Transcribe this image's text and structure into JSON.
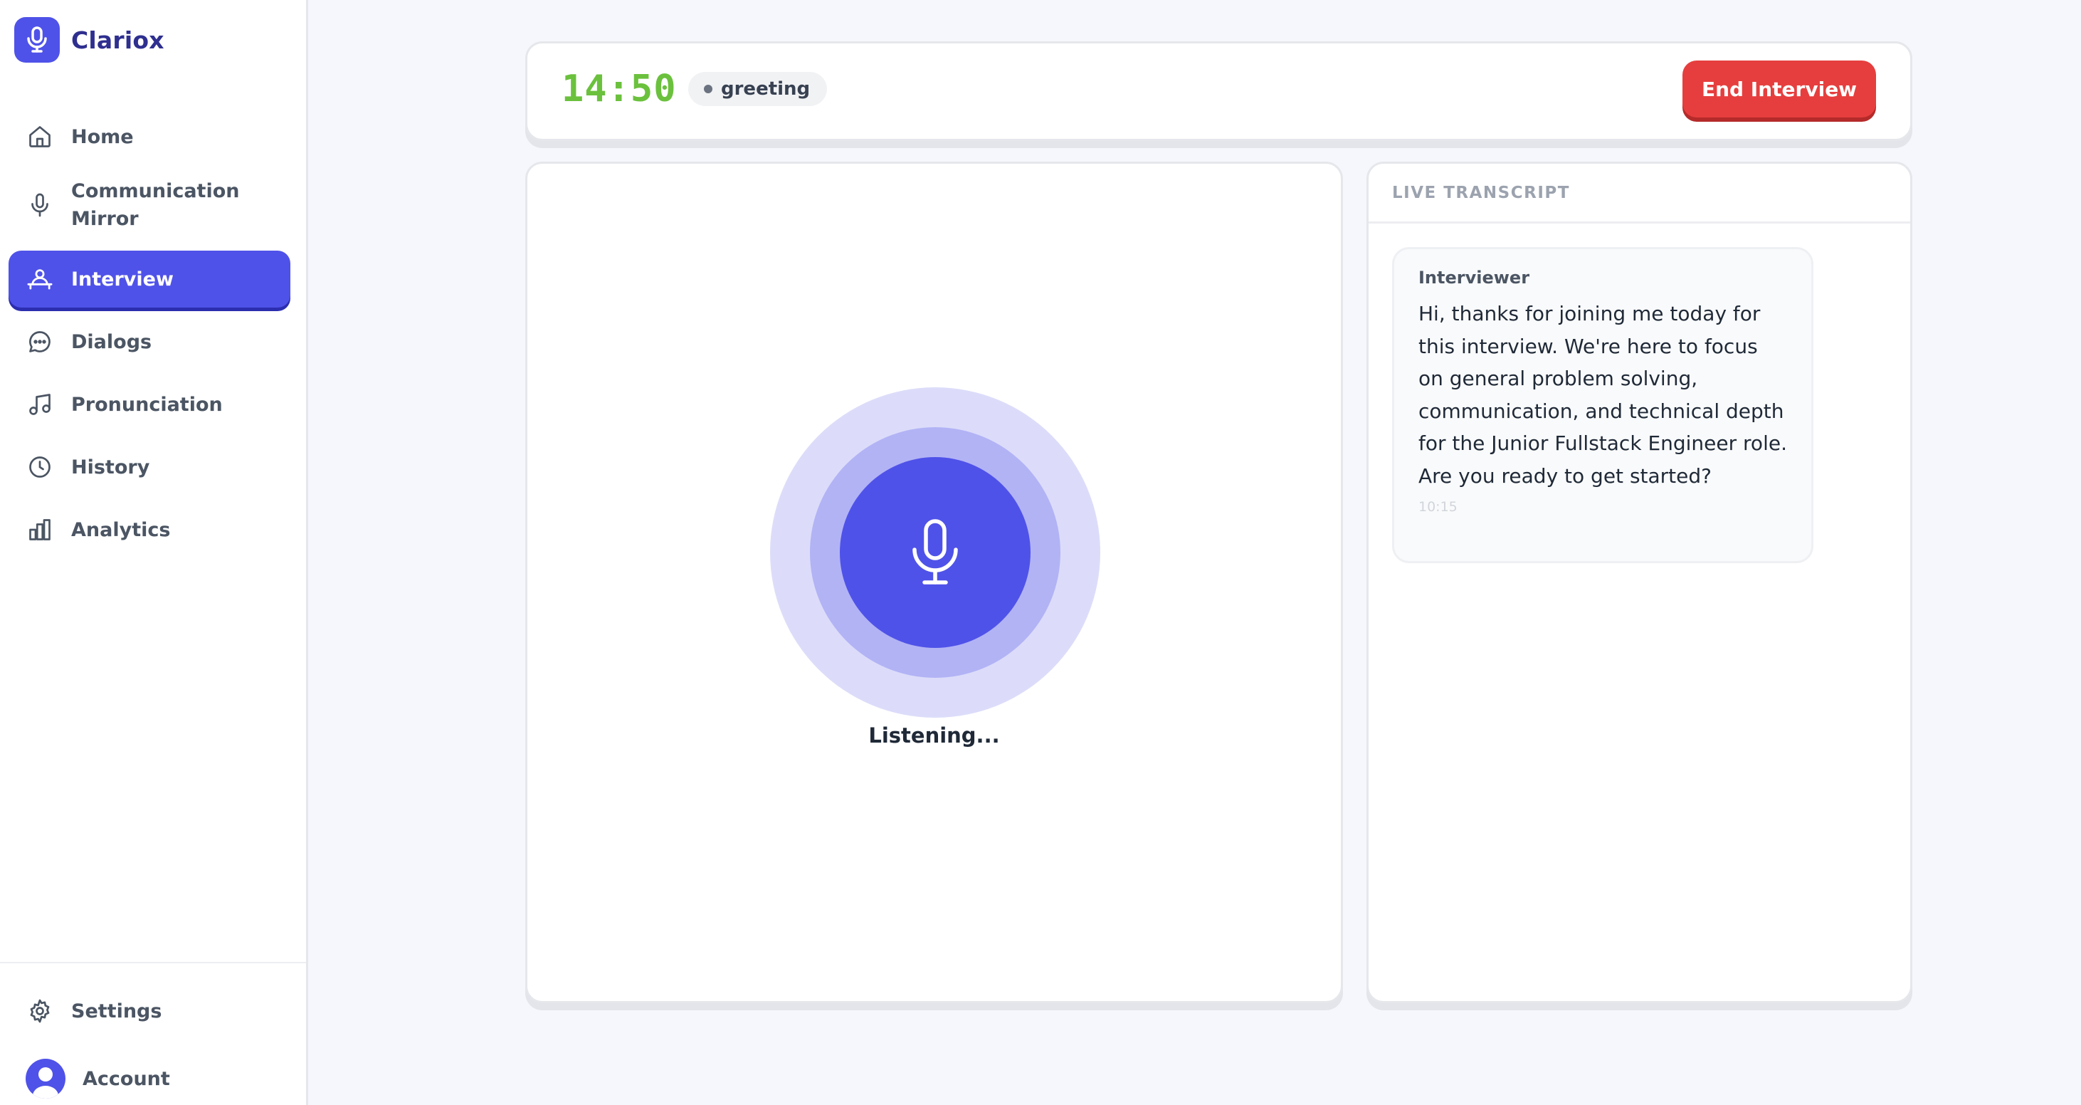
{
  "brand": {
    "name": "Clariox"
  },
  "sidebar": {
    "items": [
      {
        "label": "Home",
        "icon": "home-icon"
      },
      {
        "label": "Communication Mirror",
        "icon": "microphone-icon"
      },
      {
        "label": "Interview",
        "icon": "interview-icon",
        "active": true
      },
      {
        "label": "Dialogs",
        "icon": "chat-bubble-icon"
      },
      {
        "label": "Pronunciation",
        "icon": "music-note-icon"
      },
      {
        "label": "History",
        "icon": "clock-icon"
      },
      {
        "label": "Analytics",
        "icon": "bar-chart-icon"
      }
    ],
    "settings_label": "Settings",
    "account_label": "Account"
  },
  "header": {
    "timer": "14:50",
    "stage": "greeting",
    "end_button_label": "End Interview"
  },
  "mic": {
    "status": "Listening..."
  },
  "transcript": {
    "title": "LIVE TRANSCRIPT",
    "messages": [
      {
        "speaker": "Interviewer",
        "text": "Hi, thanks for joining me today for this interview. We're here to focus on general problem solving, communication, and technical depth for the Junior Fullstack Engineer role. Are you ready to get started?",
        "time": "10:15"
      }
    ]
  },
  "colors": {
    "accent": "#4f52e8",
    "timer": "#6bc13d",
    "danger": "#e63e3e"
  }
}
